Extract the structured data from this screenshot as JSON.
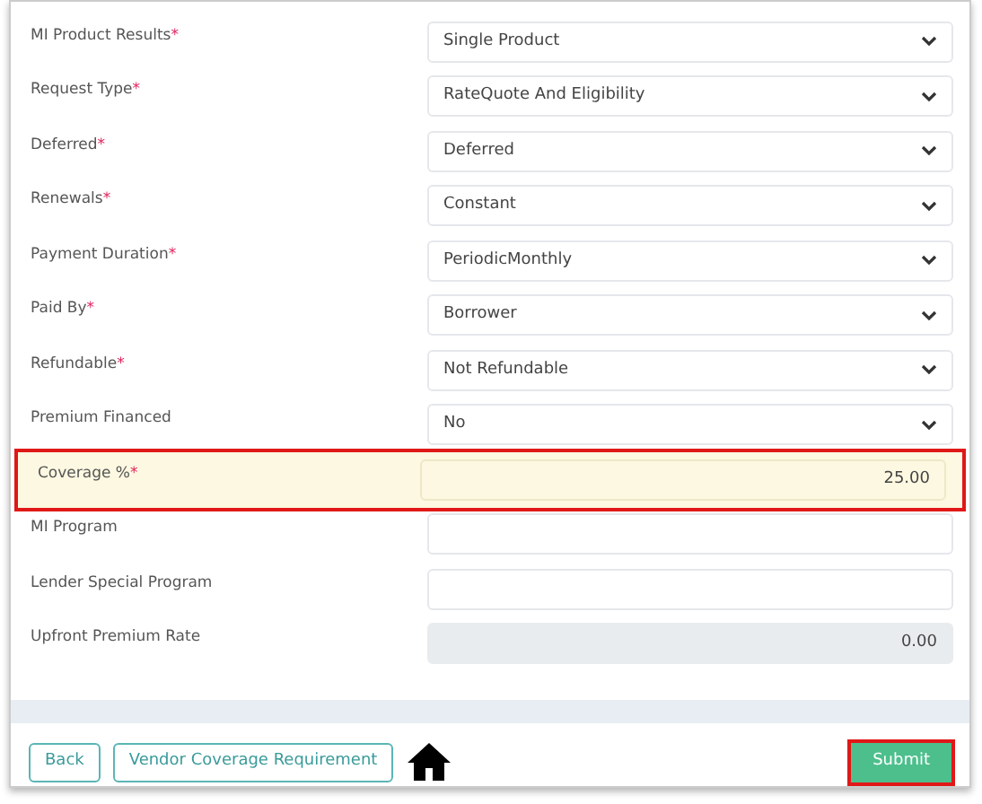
{
  "form": {
    "fields": [
      {
        "label": "MI Product Results",
        "required_mark": "*",
        "kind": "select",
        "value": "Single Product",
        "highlighted": false
      },
      {
        "label": "Request Type",
        "required_mark": "*",
        "kind": "select",
        "value": "RateQuote And Eligibility",
        "highlighted": false
      },
      {
        "label": "Deferred",
        "required_mark": "*",
        "kind": "select",
        "value": "Deferred",
        "highlighted": false
      },
      {
        "label": "Renewals",
        "required_mark": "*",
        "kind": "select",
        "value": "Constant",
        "highlighted": false
      },
      {
        "label": "Payment Duration",
        "required_mark": "*",
        "kind": "select",
        "value": "PeriodicMonthly",
        "highlighted": false
      },
      {
        "label": "Paid By",
        "required_mark": "*",
        "kind": "select",
        "value": "Borrower",
        "highlighted": false
      },
      {
        "label": "Refundable",
        "required_mark": "*",
        "kind": "select",
        "value": "Not Refundable",
        "highlighted": false
      },
      {
        "label": "Premium Financed",
        "kind": "select",
        "value": "No",
        "highlighted": false
      },
      {
        "label": "Coverage %",
        "required_mark": "*",
        "kind": "input",
        "value": "25.00",
        "highlighted": true
      },
      {
        "label": "MI Program",
        "kind": "input",
        "highlighted": false
      },
      {
        "label": "Lender Special Program",
        "kind": "input",
        "highlighted": false
      },
      {
        "label": "Upfront Premium Rate",
        "kind": "readonly",
        "value": "0.00",
        "highlighted": false
      }
    ]
  },
  "footer": {
    "buttons": [
      {
        "label": "Back",
        "kind": "outline",
        "highlighted": false
      },
      {
        "label": "Vendor Coverage Requirement",
        "kind": "outline",
        "highlighted": false
      },
      {
        "kind": "home"
      },
      {
        "label": "Submit",
        "kind": "primary",
        "highlighted": true
      }
    ]
  }
}
